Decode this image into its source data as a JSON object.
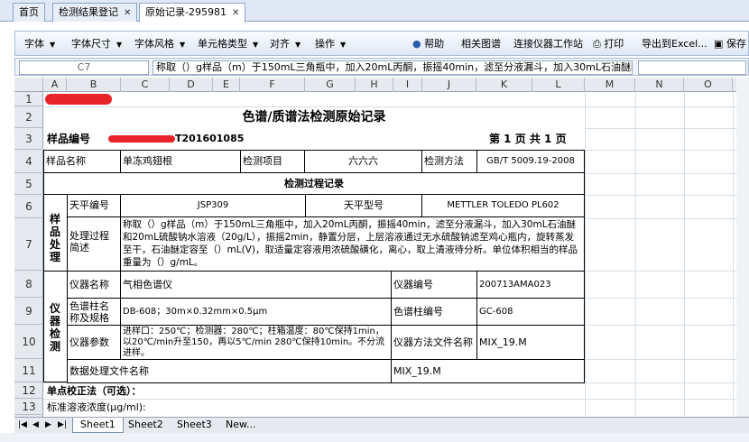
{
  "tabs": [
    {
      "label": "首页"
    },
    {
      "label": "检测结果登记",
      "close": "✕"
    },
    {
      "label": "原始记录-295981",
      "close": "✕"
    }
  ],
  "toolbar": {
    "font": "字体",
    "font_size": "字体尺寸",
    "font_style": "字体风格",
    "cell_type": "单元格类型",
    "align": "对齐",
    "operate": "操作",
    "help": "帮助",
    "related": "相关图谱",
    "connect": "连接仪器工作站",
    "print": "打印",
    "export": "导出到Excel...",
    "save": "保存"
  },
  "formula_bar": {
    "cell_ref": "C7",
    "content": "称取（）g样品（m）于150mL三角瓶中，加入20mL丙酮，振摇40min，滤至分液漏斗，加入30mL石油醚和"
  },
  "columns": [
    "A",
    "B",
    "C",
    "D",
    "E",
    "F",
    "G",
    "H",
    "I",
    "J",
    "K",
    "L",
    "M",
    "N",
    "O"
  ],
  "rows": [
    "1",
    "2",
    "3",
    "4",
    "5",
    "6",
    "7",
    "8",
    "9",
    "10",
    "11",
    "12",
    "13"
  ],
  "sheet": {
    "title": "色谱/质谱法检测原始记录",
    "sample_no_label": "样品编号",
    "sample_no_value": "T201601085",
    "page_info": "第 1 页 共 1 页",
    "sample_name_label": "样品名称",
    "sample_name": "单冻鸡翅根",
    "test_item_label": "检测项目",
    "test_item": "六六六",
    "test_method_label": "检测方法",
    "test_method": "GB/T 5009.19-2008",
    "process_title": "检测过程记录",
    "sample_proc_label": "样品处理",
    "balance_no_label": "天平编号",
    "balance_no": "JSP309",
    "balance_model_label": "天平型号",
    "balance_model": "METTLER TOLEDO PL602",
    "proc_desc_label": "处理过程简述",
    "proc_desc": "称取（）g样品（m）于150mL三角瓶中，加入20mL丙酮，振摇40min，滤至分液漏斗，加入30mL石油醚和20mL硫酸钠水溶液（20g/L），振摇2min，静置分层，上层溶液通过无水硫酸钠滤至鸡心瓶内，旋转蒸发至干，石油醚定容至（）mL(V)，取适量定容液用浓硫酸磺化，离心，取上清液待分析。单位体积相当的样品重量为（）g/mL。",
    "instr_label": "仪器检测",
    "instr_name_label": "仪器名称",
    "instr_name": "气相色谱仪",
    "instr_no_label": "仪器编号",
    "instr_no": "200713AMA023",
    "column_name_label": "色谱柱名称及规格",
    "column_spec": "DB-608；30m×0.32mm×0.5μm",
    "column_no_label": "色谱柱编号",
    "column_no": "GC-608",
    "params_label": "仪器参数",
    "params": "进样口：250℃；检测器：280℃；柱箱温度：80℃保持1min，以20℃/min升至150，再以5℃/min 280℃保持10min。不分流进样。",
    "method_file_label": "仪器方法文件名称",
    "method_file": "MIX_19.M",
    "data_file_label": "数据处理文件名称",
    "data_file": "MIX_19.M",
    "calib_label": "单点校正法（可选）：",
    "std_conc_label": "标准溶液浓度(μg/ml):"
  },
  "sheet_tabs": [
    "Sheet1",
    "Sheet2",
    "Sheet3",
    "New..."
  ],
  "colors": {
    "accent": "#dfe8f4",
    "redaction": "#e8242a",
    "grid": "#d4dde6"
  }
}
